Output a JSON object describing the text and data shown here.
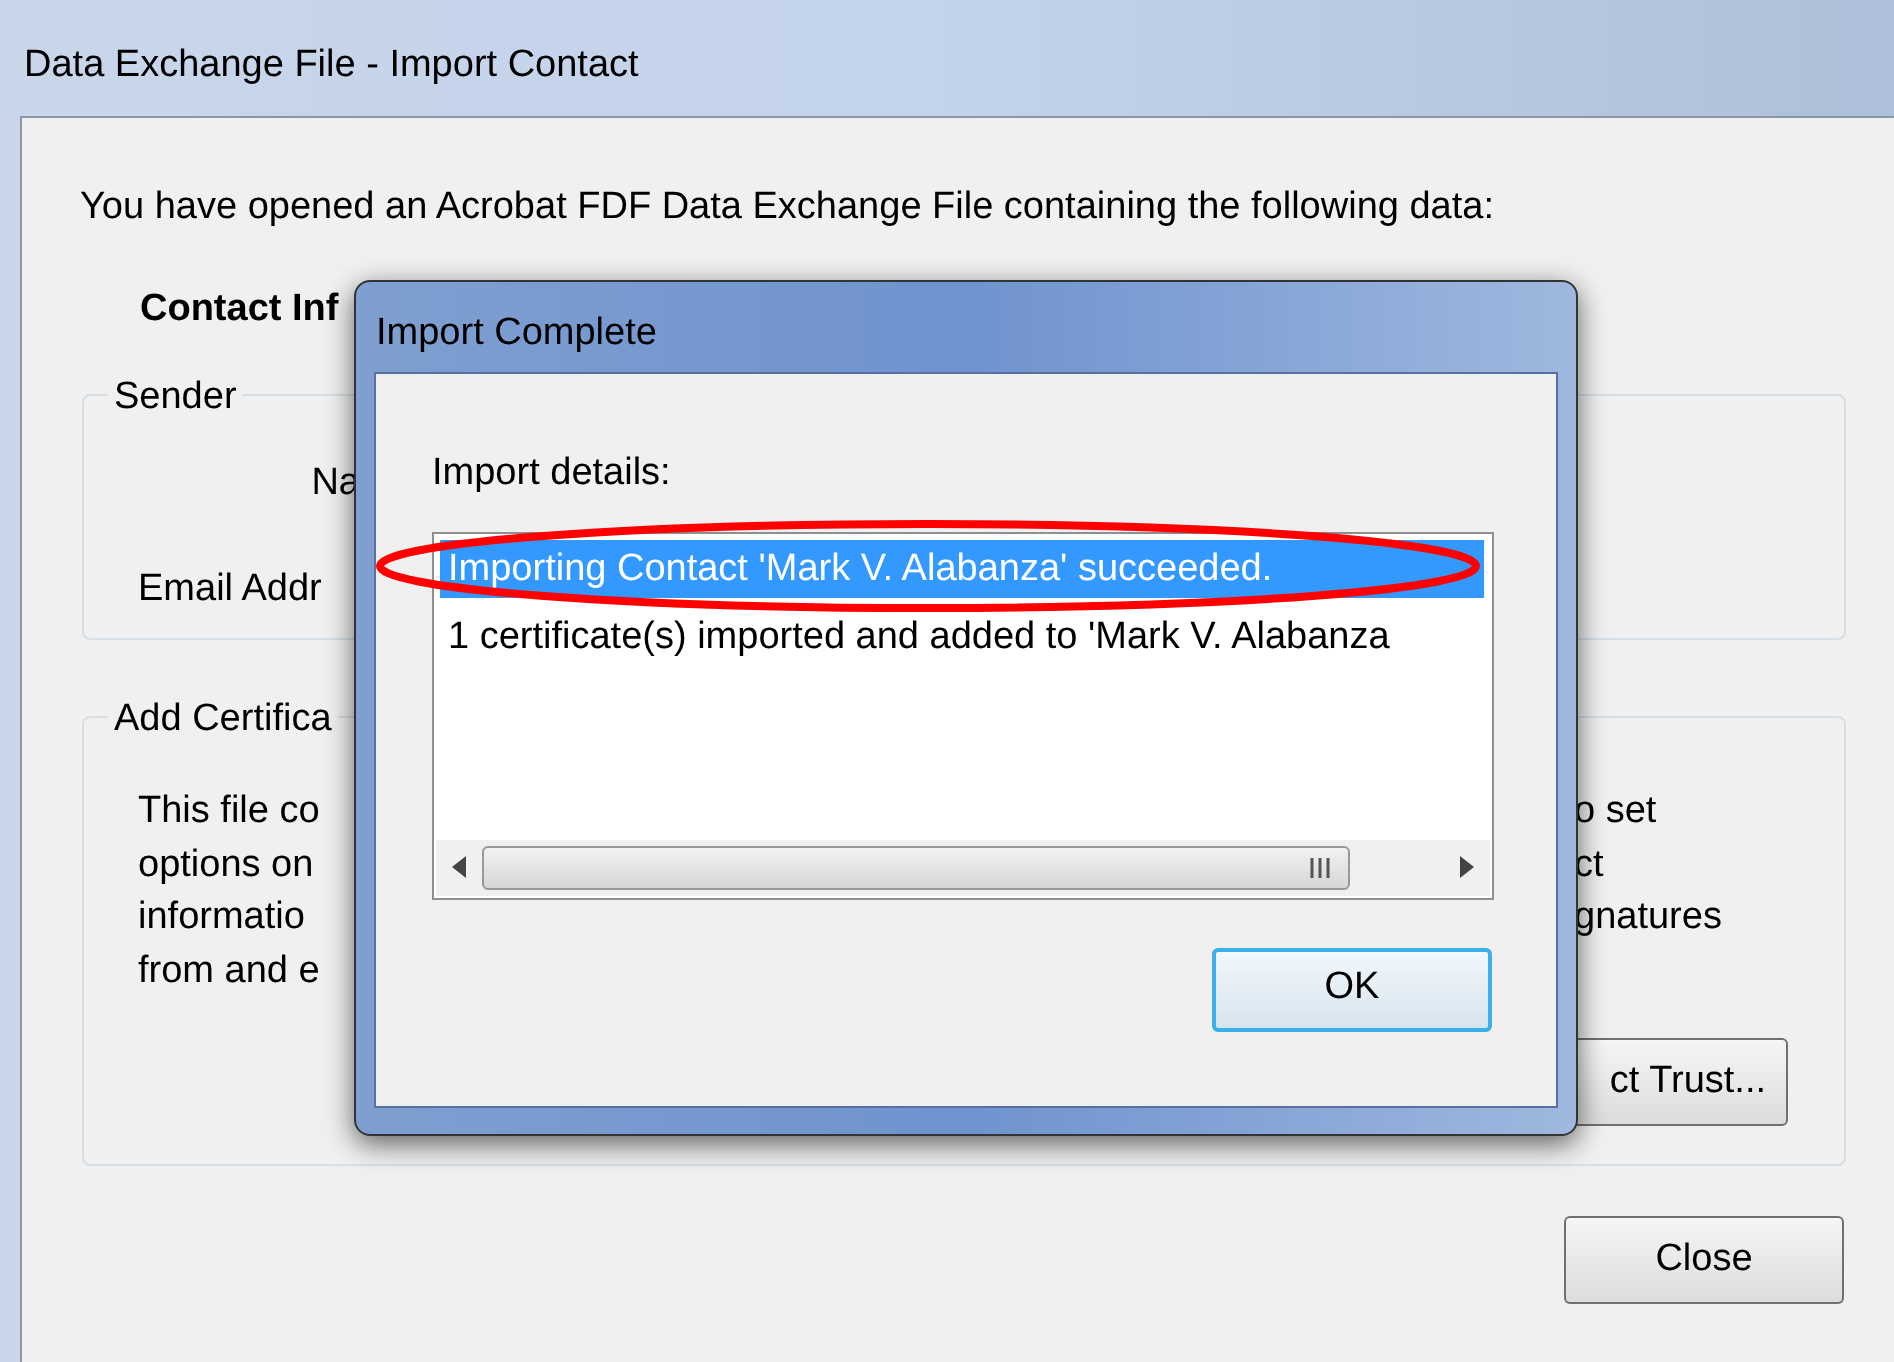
{
  "window": {
    "title": "Data Exchange File - Import Contact"
  },
  "intro": "You have opened an Acrobat FDF Data Exchange File containing the following data:",
  "section_heading": "Contact Inf",
  "sender": {
    "legend": "Sender",
    "name_label": "Na",
    "email_label": "Email Addr"
  },
  "certificate": {
    "legend": "Add Certifica",
    "text_left": [
      "This file co",
      "options on",
      "informatio",
      "from and e"
    ],
    "text_right": [
      "o set",
      "ct",
      "gnatures"
    ],
    "button": "ct Trust..."
  },
  "close_button": "Close",
  "dialog": {
    "title": "Import Complete",
    "label": "Import details:",
    "rows": [
      {
        "text": "Importing Contact 'Mark V. Alabanza' succeeded.",
        "selected": true
      },
      {
        "text": "1 certificate(s) imported and added to 'Mark V. Alabanza",
        "selected": false
      }
    ],
    "button": "OK"
  }
}
